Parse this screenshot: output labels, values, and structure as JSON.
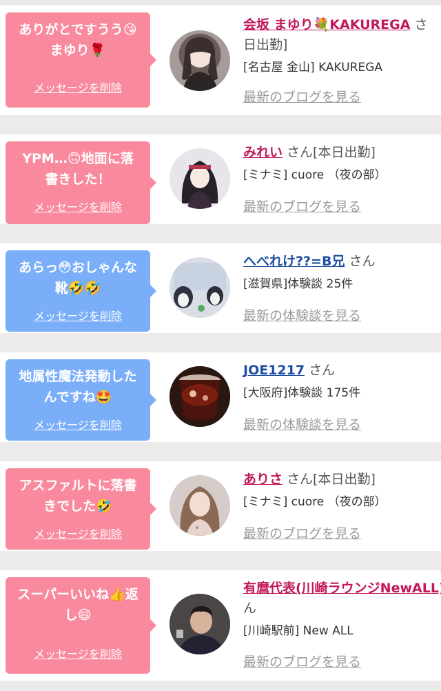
{
  "delete_label": "メッセージを削除",
  "colors": {
    "pink_bubble": "#f98a9e",
    "blue_bubble": "#7aaef9",
    "pink_name": "#c2185b",
    "blue_name": "#1f4fa3"
  },
  "items": [
    {
      "type": "pink",
      "message_lines": [
        "ありがとですうう😘",
        "まゆり🌹"
      ],
      "name": "会坂 まゆり💐KAKUREGA",
      "suffix_line1": " さ",
      "suffix_line2": "日出勤]",
      "place": "[名古屋 金山] KAKUREGA",
      "link": "最新のブログを見る"
    },
    {
      "type": "pink",
      "message_lines": [
        "YPM…🙃地面に落",
        "書きした！"
      ],
      "name": "みれい",
      "suffix_line1": " さん[本日出勤]",
      "place": "[ミナミ] cuore （夜の部）",
      "link": "最新のブログを見る"
    },
    {
      "type": "blue",
      "message_lines": [
        "あらっ😳おしゃんな",
        "靴🤣🤣"
      ],
      "name": "へべれけ??=B兄",
      "suffix_line1": " さん",
      "place": "[滋賀県]体験談 25件",
      "link": "最新の体験談を見る"
    },
    {
      "type": "blue",
      "message_lines": [
        "地属性魔法発動した",
        "んですね🤩"
      ],
      "name": "JOE1217",
      "suffix_line1": " さん",
      "place": "[大阪府]体験談 175件",
      "link": "最新の体験談を見る"
    },
    {
      "type": "pink",
      "message_lines": [
        "アスファルトに落書",
        "きでした🤣"
      ],
      "name": "ありさ",
      "suffix_line1": " さん[本日出勤]",
      "place": "[ミナミ] cuore （夜の部）",
      "link": "最新のブログを見る"
    },
    {
      "type": "pink",
      "message_lines": [
        "スーパーいいね👍返",
        "し😄"
      ],
      "name": "有麿代表(川崎ラウンジNewALL)",
      "suffix_line1": "",
      "suffix_line2": "ん",
      "place": "[川崎駅前] New ALL",
      "link": "最新のブログを見る"
    }
  ]
}
